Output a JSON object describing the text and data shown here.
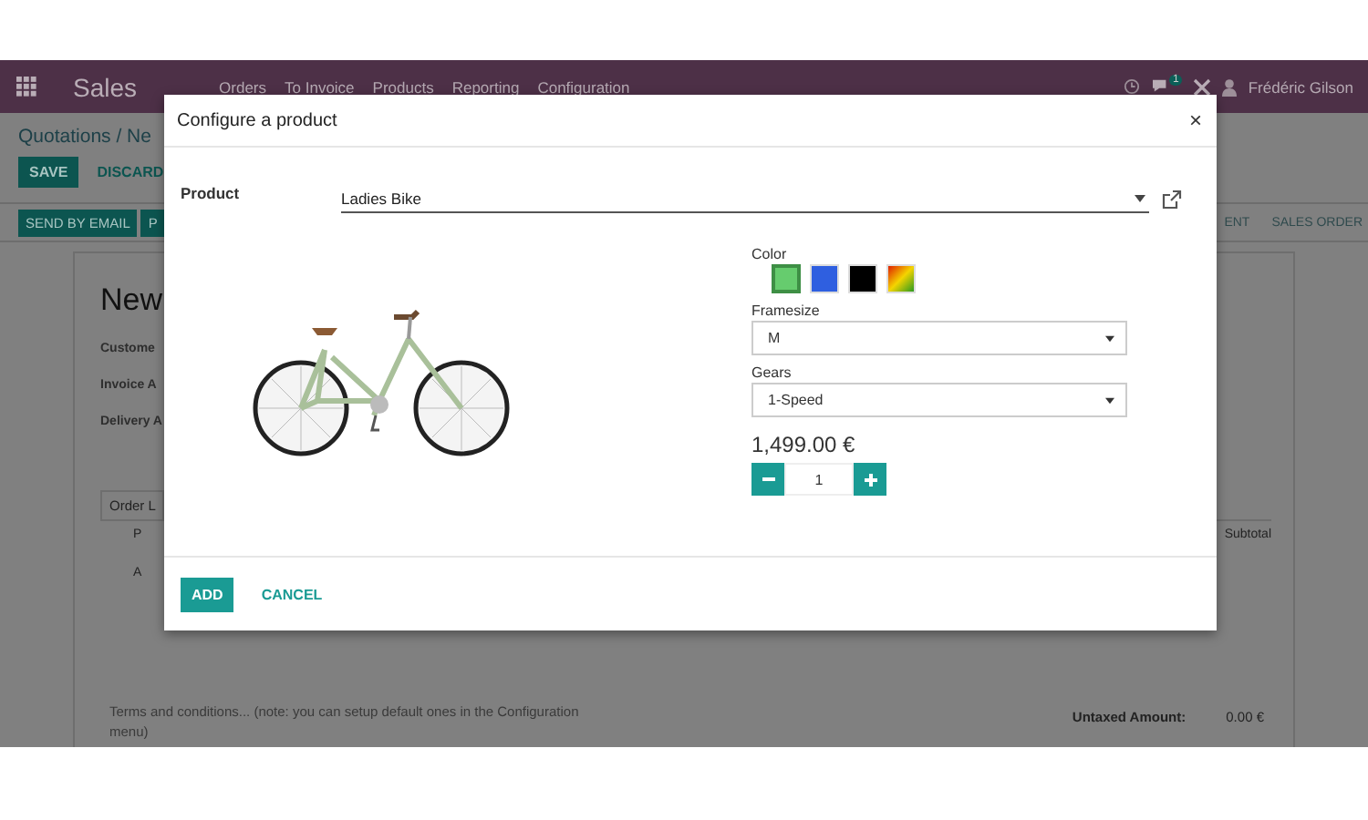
{
  "top_bar": {
    "app_name": "Sales",
    "menu": [
      "Orders",
      "To Invoice",
      "Products",
      "Reporting",
      "Configuration"
    ],
    "chat_badge": "1",
    "user": "Frédéric Gilson"
  },
  "breadcrumb": "Quotations / Ne",
  "form_buttons": [
    {
      "label": "SAVE",
      "kind": "primary"
    },
    {
      "label": "DISCARD",
      "kind": "link"
    }
  ],
  "action_buttons": [
    "SEND BY EMAIL",
    "P"
  ],
  "status_steps": [
    "ENT",
    "SALES ORDER"
  ],
  "sheet": {
    "title": "New",
    "fields": [
      "Custome",
      "Invoice A",
      "Delivery A"
    ],
    "tab": "Order L",
    "column_1": "P",
    "row_1": "A",
    "subtotal_header": "Subtotal",
    "terms": "Terms and conditions... (note: you can setup default ones in the Configuration menu)",
    "untaxed_label": "Untaxed Amount:",
    "untaxed_value": "0.00 €"
  },
  "dialog": {
    "title": "Configure a product",
    "close": "×",
    "product_label": "Product",
    "product_value": "Ladies Bike",
    "attributes": [
      {
        "kind": "color",
        "label": "Color",
        "options": [
          {
            "kind": "solid",
            "color": "#66cc6e",
            "selected": true
          },
          {
            "kind": "solid",
            "color": "#2f5fe0",
            "selected": false
          },
          {
            "kind": "solid",
            "color": "#000000",
            "selected": false
          },
          {
            "kind": "gradient",
            "selected": false
          }
        ]
      },
      {
        "kind": "select",
        "label": "Framesize",
        "value": "M"
      },
      {
        "kind": "select",
        "label": "Gears",
        "value": "1-Speed"
      }
    ],
    "price": "1,499.00 €",
    "quantity": "1",
    "buttons": [
      {
        "label": "ADD",
        "kind": "primary"
      },
      {
        "label": "CANCEL",
        "kind": "link"
      }
    ]
  }
}
